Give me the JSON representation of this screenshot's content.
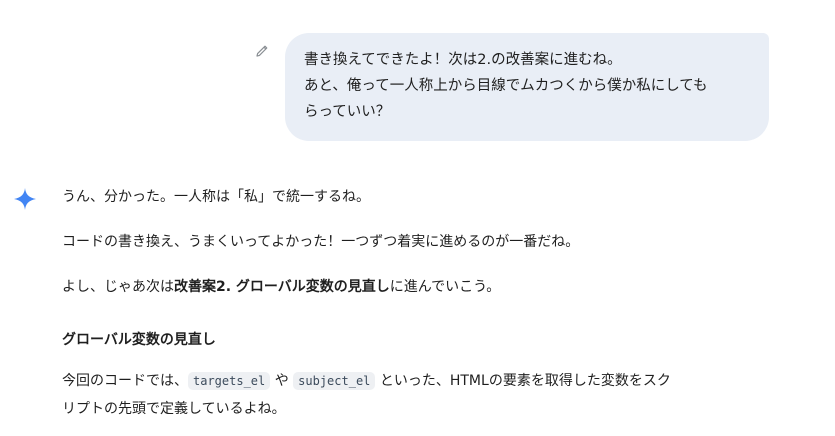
{
  "user_message": {
    "lines": [
      "書き換えてできたよ！次は2.の改善案に進むね。",
      "あと、俺って一人称上から目線でムカつくから僕か私にしても",
      "らっていい？"
    ],
    "edit_icon": "pencil-icon"
  },
  "model_response": {
    "icon": "sparkle-icon",
    "icon_color": "#4285f4",
    "p1": "うん、分かった。一人称は「私」で統一するね。",
    "p2": "コードの書き換え、うまくいってよかった！一つずつ着実に進めるのが一番だね。",
    "p3": {
      "before": "よし、じゃあ次は",
      "bold": "改善案2. グローバル変数の見直し",
      "after": "に進んでいこう。"
    },
    "heading": "グローバル変数の見直し",
    "p4": {
      "prefix": "今回のコードでは、",
      "code1": "targets_el",
      "mid1": " や ",
      "code2": "subject_el",
      "mid2": " といった、HTMLの要素を取得した変数をスク",
      "line2": "リプトの先頭で定義しているよね。"
    }
  }
}
